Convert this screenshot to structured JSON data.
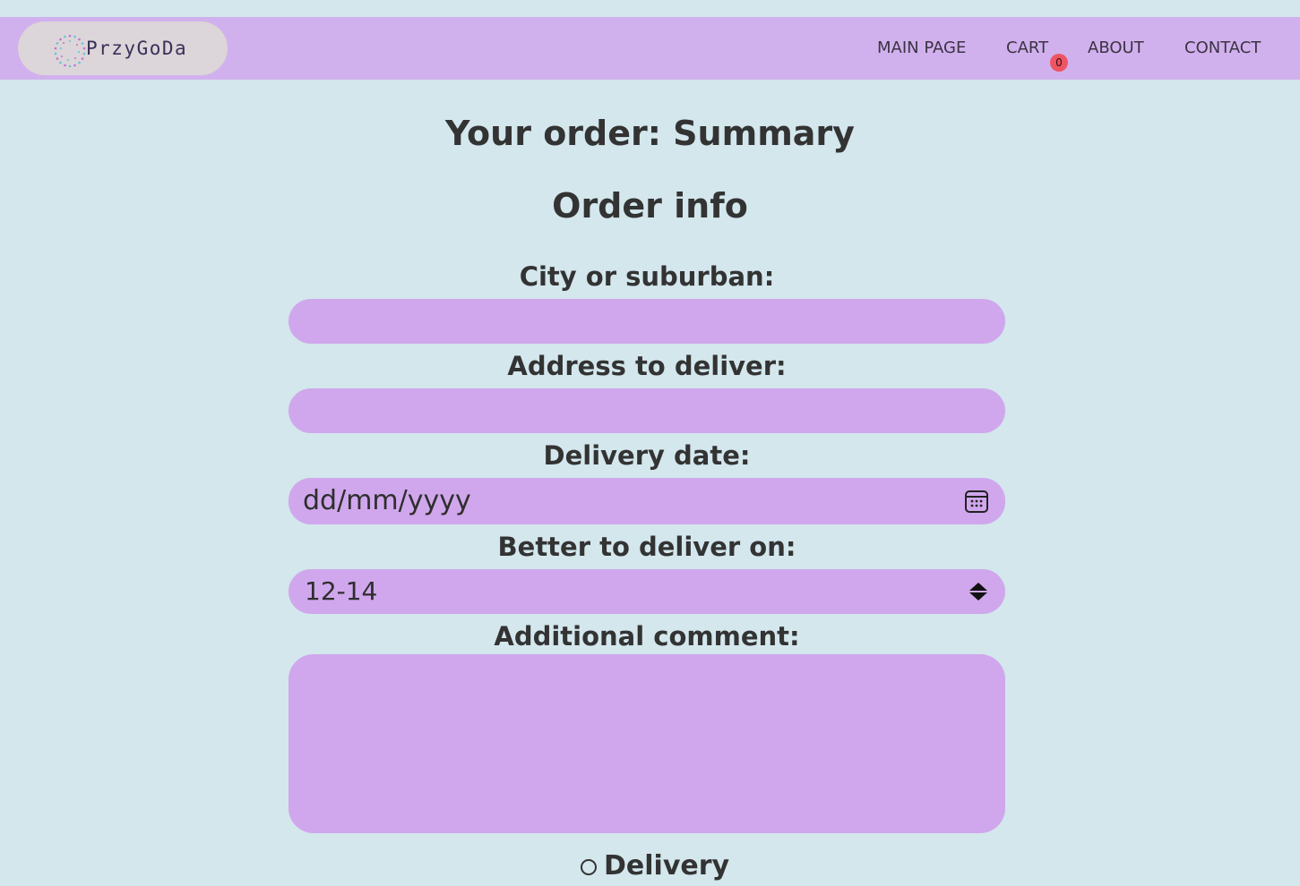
{
  "header": {
    "brand": "PrzyGoDa",
    "nav": {
      "main_page": "MAIN PAGE",
      "cart": "CART",
      "about": "ABOUT",
      "contact": "CONTACT"
    },
    "cart_count": "0"
  },
  "page": {
    "title": "Your order: Summary",
    "section_title": "Order info"
  },
  "form": {
    "city_label": "City or suburban:",
    "city_value": "",
    "address_label": "Address to deliver:",
    "address_value": "",
    "date_label": "Delivery date:",
    "date_placeholder": "dd/mm/yyyy",
    "time_label": "Better to deliver on:",
    "time_selected": "12-14",
    "comment_label": "Additional comment:",
    "comment_value": "",
    "delivery_option": "Delivery"
  },
  "colors": {
    "background": "#d3e7ed",
    "navbar": "#d1b1ed",
    "field": "#d0a7ec",
    "badge": "#ee5462",
    "text": "#333333"
  },
  "icons": [
    "logo-dots-icon",
    "calendar-icon",
    "select-arrows-icon",
    "radio-icon"
  ]
}
